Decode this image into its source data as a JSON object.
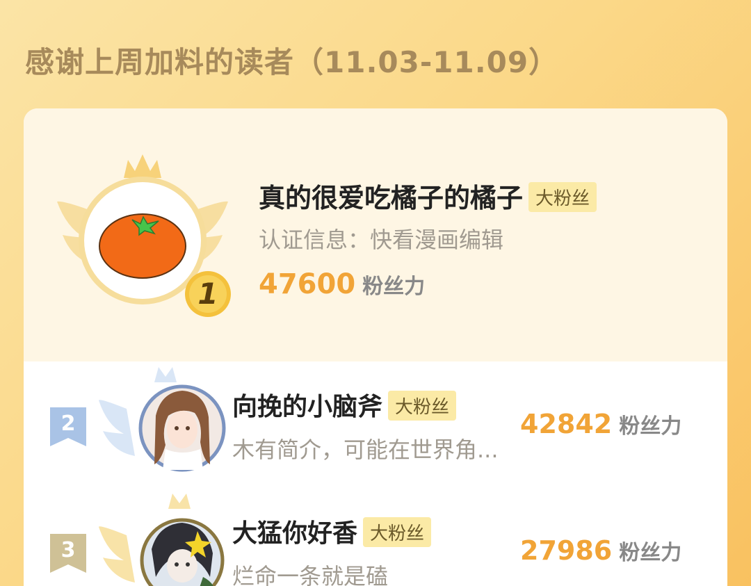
{
  "header": {
    "title": "感谢上周加料的读者（11.03-11.09）"
  },
  "colors": {
    "accent": "#f1a437",
    "badge_bg": "#fbeaa6",
    "background": "#fbd888"
  },
  "rankings": [
    {
      "rank": "1",
      "name": "真的很爱吃橘子的橘子",
      "badge": "大粉丝",
      "verify": "认证信息：快看漫画编辑",
      "score": "47600",
      "unit": "粉丝力",
      "avatar_icon": "tangerine-avatar"
    },
    {
      "rank": "2",
      "name": "向挽的小脑斧",
      "badge": "大粉丝",
      "desc": "木有简介，可能在世界角...",
      "score": "42842",
      "unit": "粉丝力",
      "avatar_icon": "anime-girl-avatar"
    },
    {
      "rank": "3",
      "name": "大猛你好香",
      "badge": "大粉丝",
      "desc": "烂命一条就是磕",
      "score": "27986",
      "unit": "粉丝力",
      "avatar_icon": "anime-character-avatar"
    }
  ]
}
